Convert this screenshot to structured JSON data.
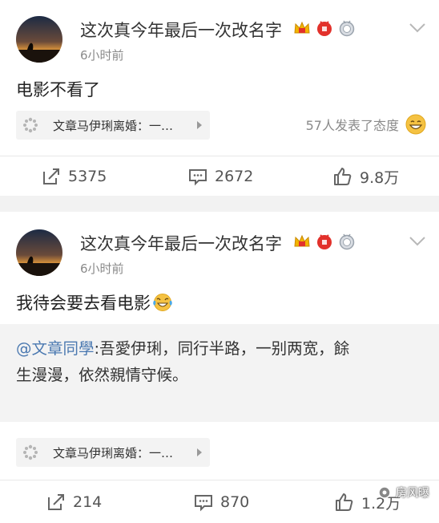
{
  "posts": [
    {
      "user": "这次真今年最后一次改名字",
      "time": "6小时前",
      "text": "电影不看了",
      "topic": "文章马伊琍离婚：一…",
      "attitude": "57人发表了态度",
      "actions": {
        "repost": "5375",
        "comment": "2672",
        "like": "9.8万"
      }
    },
    {
      "user": "这次真今年最后一次改名字",
      "time": "6小时前",
      "text": "我待会要去看电影",
      "emoji": "cry-laugh-emoji",
      "repost": {
        "mention": "@文章同學",
        "text_line1": ":吾愛伊琍，同行半路，一别两宽，餘",
        "text_line2": "生漫漫，依然親情守候。"
      },
      "topic": "文章马伊琍离婚：一…",
      "actions": {
        "repost": "214",
        "comment": "870",
        "like": "1.2万"
      }
    }
  ],
  "watermark": "房风曝",
  "colors": {
    "mention": "#4a78b0",
    "badge_red": "#e2312b",
    "badge_gold": "#f3b400"
  }
}
